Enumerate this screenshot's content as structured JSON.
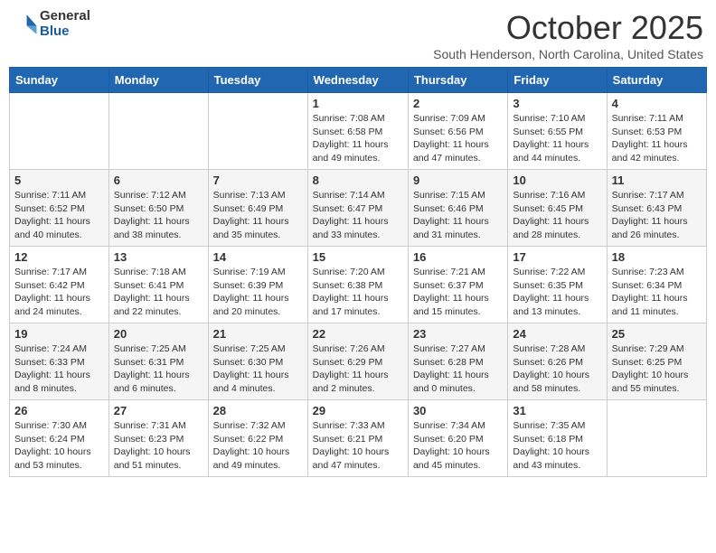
{
  "logo": {
    "general": "General",
    "blue": "Blue"
  },
  "title": "October 2025",
  "subtitle": "South Henderson, North Carolina, United States",
  "days_header": [
    "Sunday",
    "Monday",
    "Tuesday",
    "Wednesday",
    "Thursday",
    "Friday",
    "Saturday"
  ],
  "weeks": [
    [
      {
        "day": "",
        "info": ""
      },
      {
        "day": "",
        "info": ""
      },
      {
        "day": "",
        "info": ""
      },
      {
        "day": "1",
        "info": "Sunrise: 7:08 AM\nSunset: 6:58 PM\nDaylight: 11 hours and 49 minutes."
      },
      {
        "day": "2",
        "info": "Sunrise: 7:09 AM\nSunset: 6:56 PM\nDaylight: 11 hours and 47 minutes."
      },
      {
        "day": "3",
        "info": "Sunrise: 7:10 AM\nSunset: 6:55 PM\nDaylight: 11 hours and 44 minutes."
      },
      {
        "day": "4",
        "info": "Sunrise: 7:11 AM\nSunset: 6:53 PM\nDaylight: 11 hours and 42 minutes."
      }
    ],
    [
      {
        "day": "5",
        "info": "Sunrise: 7:11 AM\nSunset: 6:52 PM\nDaylight: 11 hours and 40 minutes."
      },
      {
        "day": "6",
        "info": "Sunrise: 7:12 AM\nSunset: 6:50 PM\nDaylight: 11 hours and 38 minutes."
      },
      {
        "day": "7",
        "info": "Sunrise: 7:13 AM\nSunset: 6:49 PM\nDaylight: 11 hours and 35 minutes."
      },
      {
        "day": "8",
        "info": "Sunrise: 7:14 AM\nSunset: 6:47 PM\nDaylight: 11 hours and 33 minutes."
      },
      {
        "day": "9",
        "info": "Sunrise: 7:15 AM\nSunset: 6:46 PM\nDaylight: 11 hours and 31 minutes."
      },
      {
        "day": "10",
        "info": "Sunrise: 7:16 AM\nSunset: 6:45 PM\nDaylight: 11 hours and 28 minutes."
      },
      {
        "day": "11",
        "info": "Sunrise: 7:17 AM\nSunset: 6:43 PM\nDaylight: 11 hours and 26 minutes."
      }
    ],
    [
      {
        "day": "12",
        "info": "Sunrise: 7:17 AM\nSunset: 6:42 PM\nDaylight: 11 hours and 24 minutes."
      },
      {
        "day": "13",
        "info": "Sunrise: 7:18 AM\nSunset: 6:41 PM\nDaylight: 11 hours and 22 minutes."
      },
      {
        "day": "14",
        "info": "Sunrise: 7:19 AM\nSunset: 6:39 PM\nDaylight: 11 hours and 20 minutes."
      },
      {
        "day": "15",
        "info": "Sunrise: 7:20 AM\nSunset: 6:38 PM\nDaylight: 11 hours and 17 minutes."
      },
      {
        "day": "16",
        "info": "Sunrise: 7:21 AM\nSunset: 6:37 PM\nDaylight: 11 hours and 15 minutes."
      },
      {
        "day": "17",
        "info": "Sunrise: 7:22 AM\nSunset: 6:35 PM\nDaylight: 11 hours and 13 minutes."
      },
      {
        "day": "18",
        "info": "Sunrise: 7:23 AM\nSunset: 6:34 PM\nDaylight: 11 hours and 11 minutes."
      }
    ],
    [
      {
        "day": "19",
        "info": "Sunrise: 7:24 AM\nSunset: 6:33 PM\nDaylight: 11 hours and 8 minutes."
      },
      {
        "day": "20",
        "info": "Sunrise: 7:25 AM\nSunset: 6:31 PM\nDaylight: 11 hours and 6 minutes."
      },
      {
        "day": "21",
        "info": "Sunrise: 7:25 AM\nSunset: 6:30 PM\nDaylight: 11 hours and 4 minutes."
      },
      {
        "day": "22",
        "info": "Sunrise: 7:26 AM\nSunset: 6:29 PM\nDaylight: 11 hours and 2 minutes."
      },
      {
        "day": "23",
        "info": "Sunrise: 7:27 AM\nSunset: 6:28 PM\nDaylight: 11 hours and 0 minutes."
      },
      {
        "day": "24",
        "info": "Sunrise: 7:28 AM\nSunset: 6:26 PM\nDaylight: 10 hours and 58 minutes."
      },
      {
        "day": "25",
        "info": "Sunrise: 7:29 AM\nSunset: 6:25 PM\nDaylight: 10 hours and 55 minutes."
      }
    ],
    [
      {
        "day": "26",
        "info": "Sunrise: 7:30 AM\nSunset: 6:24 PM\nDaylight: 10 hours and 53 minutes."
      },
      {
        "day": "27",
        "info": "Sunrise: 7:31 AM\nSunset: 6:23 PM\nDaylight: 10 hours and 51 minutes."
      },
      {
        "day": "28",
        "info": "Sunrise: 7:32 AM\nSunset: 6:22 PM\nDaylight: 10 hours and 49 minutes."
      },
      {
        "day": "29",
        "info": "Sunrise: 7:33 AM\nSunset: 6:21 PM\nDaylight: 10 hours and 47 minutes."
      },
      {
        "day": "30",
        "info": "Sunrise: 7:34 AM\nSunset: 6:20 PM\nDaylight: 10 hours and 45 minutes."
      },
      {
        "day": "31",
        "info": "Sunrise: 7:35 AM\nSunset: 6:18 PM\nDaylight: 10 hours and 43 minutes."
      },
      {
        "day": "",
        "info": ""
      }
    ]
  ]
}
